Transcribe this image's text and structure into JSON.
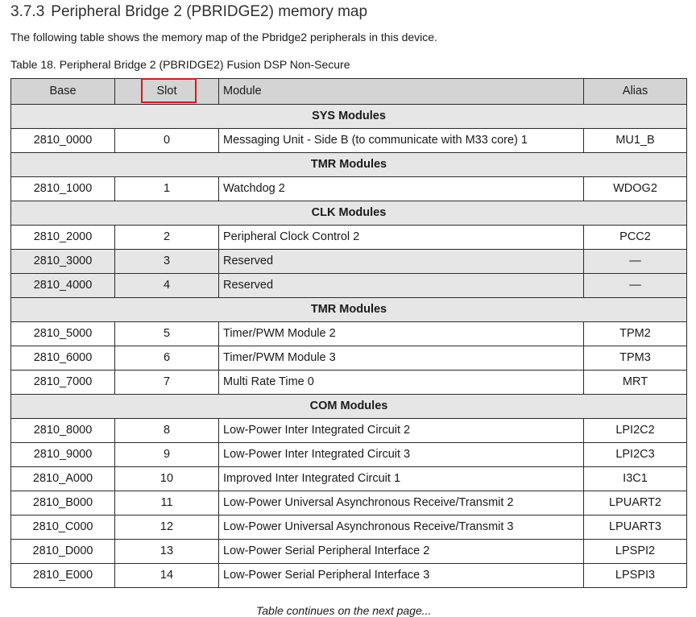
{
  "section": {
    "number": "3.7.3",
    "title": "Peripheral Bridge 2 (PBRIDGE2) memory map"
  },
  "intro": "The following table shows the memory map of the Pbridge2 peripherals in this device.",
  "table": {
    "caption": "Table 18.  Peripheral Bridge 2 (PBRIDGE2) Fusion DSP Non-Secure",
    "headers": {
      "base": "Base",
      "slot": "Slot",
      "module": "Module",
      "alias": "Alias"
    },
    "highlighted_header": "Slot",
    "rows": [
      {
        "group": "SYS Modules"
      },
      {
        "base": "2810_0000",
        "slot": "0",
        "module": "Messaging Unit - Side B (to communicate with M33 core) 1",
        "alias": "MU1_B"
      },
      {
        "group": "TMR Modules"
      },
      {
        "base": "2810_1000",
        "slot": "1",
        "module": "Watchdog 2",
        "alias": "WDOG2"
      },
      {
        "group": "CLK Modules"
      },
      {
        "base": "2810_2000",
        "slot": "2",
        "module": "Peripheral Clock Control 2",
        "alias": "PCC2"
      },
      {
        "base": "2810_3000",
        "slot": "3",
        "module": "Reserved",
        "alias": "—",
        "shaded": true
      },
      {
        "base": "2810_4000",
        "slot": "4",
        "module": "Reserved",
        "alias": "—",
        "shaded": true
      },
      {
        "group": "TMR Modules"
      },
      {
        "base": "2810_5000",
        "slot": "5",
        "module": "Timer/PWM Module 2",
        "alias": "TPM2"
      },
      {
        "base": "2810_6000",
        "slot": "6",
        "module": "Timer/PWM Module 3",
        "alias": "TPM3"
      },
      {
        "base": "2810_7000",
        "slot": "7",
        "module": "Multi Rate Time 0",
        "alias": "MRT"
      },
      {
        "group": "COM Modules"
      },
      {
        "base": "2810_8000",
        "slot": "8",
        "module": "Low-Power Inter Integrated Circuit 2",
        "alias": "LPI2C2"
      },
      {
        "base": "2810_9000",
        "slot": "9",
        "module": "Low-Power Inter Integrated Circuit 3",
        "alias": "LPI2C3"
      },
      {
        "base": "2810_A000",
        "slot": "10",
        "module": "Improved Inter Integrated Circuit 1",
        "alias": "I3C1"
      },
      {
        "base": "2810_B000",
        "slot": "11",
        "module": "Low-Power Universal Asynchronous Receive/Transmit 2",
        "alias": "LPUART2"
      },
      {
        "base": "2810_C000",
        "slot": "12",
        "module": "Low-Power Universal Asynchronous Receive/Transmit 3",
        "alias": "LPUART3"
      },
      {
        "base": "2810_D000",
        "slot": "13",
        "module": "Low-Power Serial Peripheral Interface 2",
        "alias": "LPSPI2"
      },
      {
        "base": "2810_E000",
        "slot": "14",
        "module": "Low-Power Serial Peripheral Interface 3",
        "alias": "LPSPI3"
      }
    ]
  },
  "footer_note": "Table continues on the next page...",
  "colors": {
    "highlight_box": "#e0151b",
    "header_bg": "#d4d4d4",
    "group_bg": "#e6e6e6"
  }
}
